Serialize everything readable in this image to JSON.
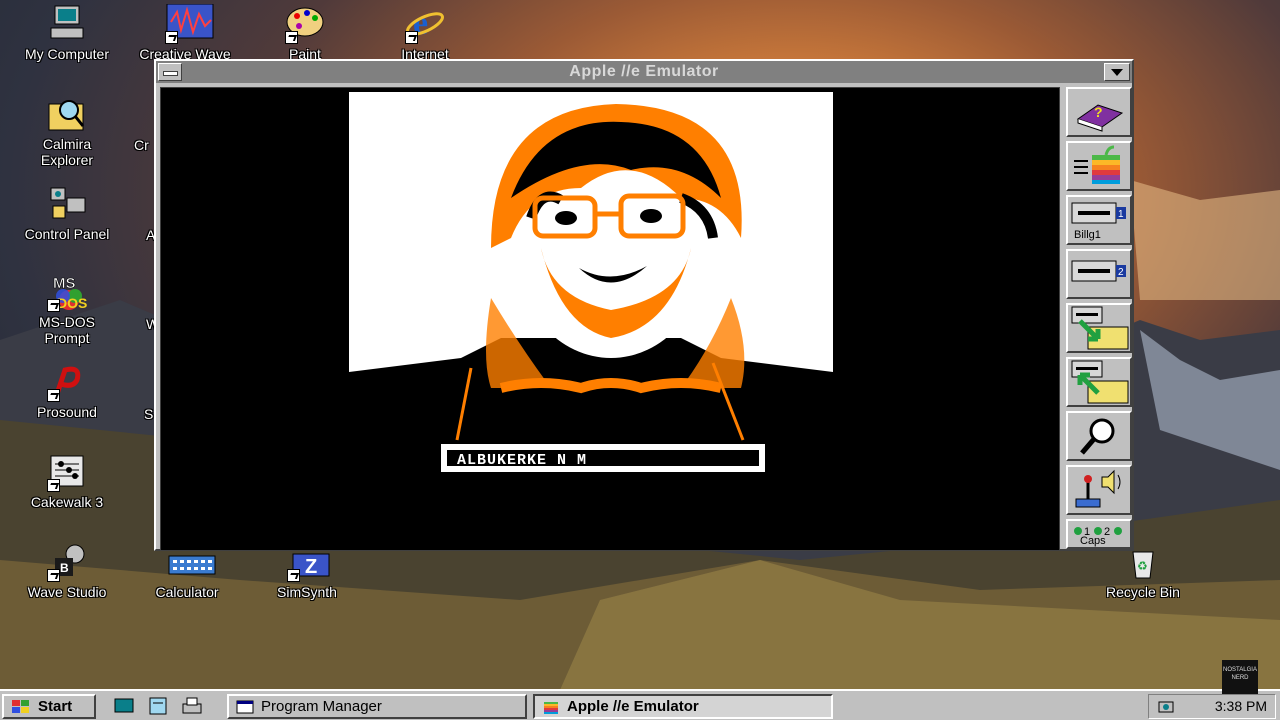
{
  "desktop": {
    "icons": [
      {
        "label": "My Computer",
        "icon": "my-computer-icon"
      },
      {
        "label": "Creative Wave",
        "icon": "wave-editor-icon"
      },
      {
        "label": "Paint",
        "icon": "paint-palette-icon"
      },
      {
        "label": "Internet",
        "icon": "internet-explorer-icon"
      },
      {
        "label": "Calmira Explorer",
        "icon": "magnifier-folder-icon"
      },
      {
        "label": "Control Panel",
        "icon": "control-panel-icon"
      },
      {
        "label": "MS-DOS Prompt",
        "icon": "ms-dos-icon"
      },
      {
        "label": "Prosound",
        "icon": "prosound-icon"
      },
      {
        "label": "Cakewalk 3",
        "icon": "cakewalk-icon"
      },
      {
        "label": "Wave Studio",
        "icon": "wave-studio-icon"
      },
      {
        "label": "Calculator",
        "icon": "calculator-icon"
      },
      {
        "label": "SimSynth",
        "icon": "simsynth-icon"
      },
      {
        "label": "Recycle Bin",
        "icon": "recycle-bin-icon"
      }
    ],
    "partial_labels": [
      "Cr",
      "A",
      "W",
      "S"
    ]
  },
  "window": {
    "title": "Apple //e Emulator",
    "screen_caption": "ALBUKERKE N M",
    "toolbar": [
      {
        "name": "help-book",
        "icon": "help-book-icon"
      },
      {
        "name": "reset-apple",
        "icon": "apple-logo-icon"
      },
      {
        "name": "disk-drive-1",
        "icon": "disk-drive-icon",
        "label": "Billg1",
        "drive": "1"
      },
      {
        "name": "disk-drive-2",
        "icon": "disk-drive-icon",
        "drive": "2"
      },
      {
        "name": "save-disk",
        "icon": "disk-save-icon"
      },
      {
        "name": "load-disk",
        "icon": "disk-load-icon"
      },
      {
        "name": "debugger",
        "icon": "magnifier-icon"
      },
      {
        "name": "settings",
        "icon": "joystick-speaker-icon"
      },
      {
        "name": "status-leds",
        "icon": "led-status-icon",
        "led1": "1",
        "led2": "2",
        "caps": "Caps"
      }
    ]
  },
  "taskbar": {
    "start_label": "Start",
    "quick_launch": [
      "desktop-icon",
      "notepad-icon",
      "printer-icon"
    ],
    "tasks": [
      {
        "label": "Program Manager",
        "active": false
      },
      {
        "label": "Apple //e Emulator",
        "active": true
      }
    ],
    "clock": "3:38 PM"
  },
  "watermark": {
    "text": "NOSTALGIA NERD"
  },
  "colors": {
    "orange": "#ff7f00",
    "titlebar_inactive": "#808080",
    "face": "#c0c0c0"
  }
}
